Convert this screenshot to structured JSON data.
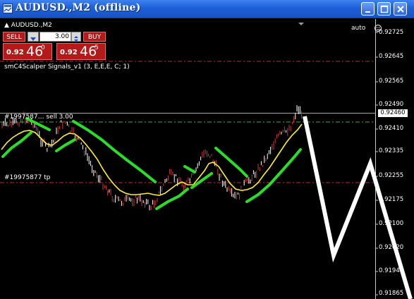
{
  "window": {
    "title": "AUDUSD.,M2 (offline)",
    "buttons": {
      "minimize": "minimize",
      "maximize": "maximize",
      "close": "close"
    }
  },
  "chart": {
    "symbol_label": "▲ AUDUSD.,M2",
    "auto_label": "auto",
    "indicator_label": "smC4Scalper Signals_v1 (3, E,E,E, C; 1)",
    "order_label": "#1997587… sell 3.00",
    "tp_label": "#19975877 tp",
    "current_price": "0.92460",
    "price_axis": [
      "0.92725",
      "0.92645",
      "0.92565",
      "0.92490",
      "0.92410",
      "0.92335",
      "0.92255",
      "0.92175",
      "0.92100",
      "0.92020",
      "0.91940",
      "0.91865"
    ]
  },
  "trade_panel": {
    "sell_label": "SELL",
    "buy_label": "BUY",
    "lot_value": "3.00",
    "sell_price_small": "0.92",
    "sell_price_big": "46",
    "sell_price_sup": "0",
    "buy_price_small": "0.92",
    "buy_price_big": "46",
    "buy_price_sup": "5"
  },
  "colors": {
    "title_bar": "#1d5fd8",
    "background": "#000000",
    "candle_up": "#ffffff",
    "candle_down": "#c43a3a",
    "ma_fast": "#ffee33",
    "signal_line": "#2bdc2b",
    "order_line": "#c0c0c0",
    "tp_line": "#c62828",
    "dashed_green": "#3fae3f",
    "button_red": "#b51a1a"
  }
}
